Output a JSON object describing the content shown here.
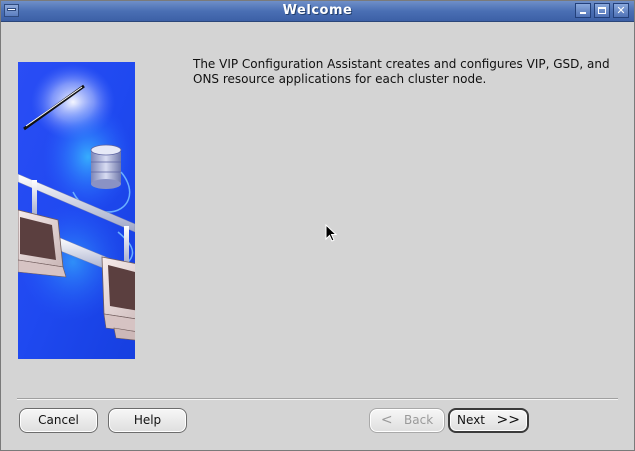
{
  "window": {
    "title": "Welcome"
  },
  "content": {
    "intro_text": "The VIP Configuration Assistant creates and configures VIP, GSD, and ONS resource applications for each cluster node."
  },
  "buttons": {
    "cancel": "Cancel",
    "help": "Help",
    "back": "Back",
    "next": "Next",
    "back_arrow": "<",
    "next_arrow": ">>"
  },
  "colors": {
    "titlebar": "#4a6fb4",
    "illustration_bg": "#1a4cf2",
    "window_bg": "#d4d4d4"
  }
}
